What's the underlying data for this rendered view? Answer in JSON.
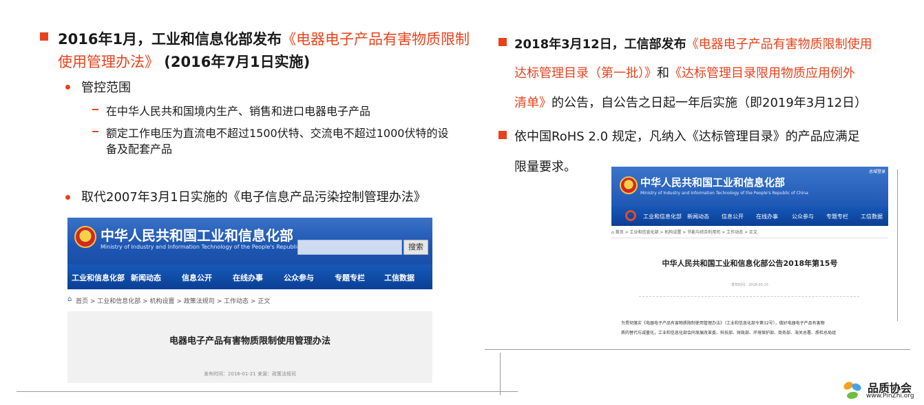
{
  "left": {
    "bullet1": {
      "line1_lead": "2016年1月，工业和信息化部发布",
      "line1_red": "《电器电子产品有害物质限制",
      "line2_red": "使用管理办法》",
      "line2_tail": " (2016年7月1日实施)"
    },
    "sub1": "管控范围",
    "sub1_items": [
      "在中华人民共和国境内生产、销售和进口电器电子产品",
      "额定工作电压为直流电不超过1500伏特、交流电不超过1000伏特的设",
      "备及配套产品"
    ],
    "sub2": "取代2007年3月1日实施的《电子信息产品污染控制管理办法》"
  },
  "right": {
    "bullet1": {
      "line1_lead": "2018年3月12日，工信部发布",
      "line1_red": "《电器电子产品有害物质限制使用",
      "line2_red": "达标管理目录（第一批）》",
      "line2_mid": "和",
      "line2_red2": "《达标管理目录限用物质应用例外",
      "line3_red": "清单》",
      "line3_tail": "的公告，自公告之日起一年后实施（即2019年3月12日）"
    },
    "bullet2": {
      "line1": "依中国RoHS 2.0 规定，凡纳入《达标管理目录》的产品应满足",
      "line2": "限量要求。"
    }
  },
  "shot1": {
    "title": "中华人民共和国工业和信息化部",
    "subtitle": "Ministry of Industry and Information Technology of the People's Republic of China",
    "search_button": "搜索",
    "nav": [
      "工业和信息化部",
      "新闻动态",
      "信息公开",
      "在线办事",
      "公众参与",
      "专题专栏",
      "工信数据"
    ],
    "breadcrumb": "首页 > 工业和信息化部 > 机构设置 > 政策法规司 > 工作动态 > 正文",
    "doc_title": "电器电子产品有害物质限制使用管理办法",
    "meta": "发布时间：2016-01-21 来源：政策法规司"
  },
  "shot2": {
    "top_right": "总域登录",
    "title": "中华人民共和国工业和信息化部",
    "subtitle": "Ministry of Industry and Information Technology of the People's Republic of China",
    "nav": [
      "工业和信息化部",
      "新闻动态",
      "信息公开",
      "在线办事",
      "公众参与",
      "专题专栏",
      "工信数据"
    ],
    "breadcrumb": "首页 > 工业和信息化部 > 机构设置 > 节能与综合利用司 > 工作动态 > 正文",
    "doc_title": "中华人民共和国工业和信息化部公告2018年第15号",
    "date": "发布时间：2018-03-15",
    "para1": "为贯彻落实《电器电子产品有害物质限制使用管理办法》（工业和信息化部令第32号），做好电器电子产品有害物",
    "para2": "质的替代与减量化，工业和信息化部会同发展改革委、科技部、财政部、环境保护部、商务部、海关总署、质检总局组"
  },
  "brand": {
    "name": "品质协会",
    "url": "www.PinZhi.org"
  }
}
